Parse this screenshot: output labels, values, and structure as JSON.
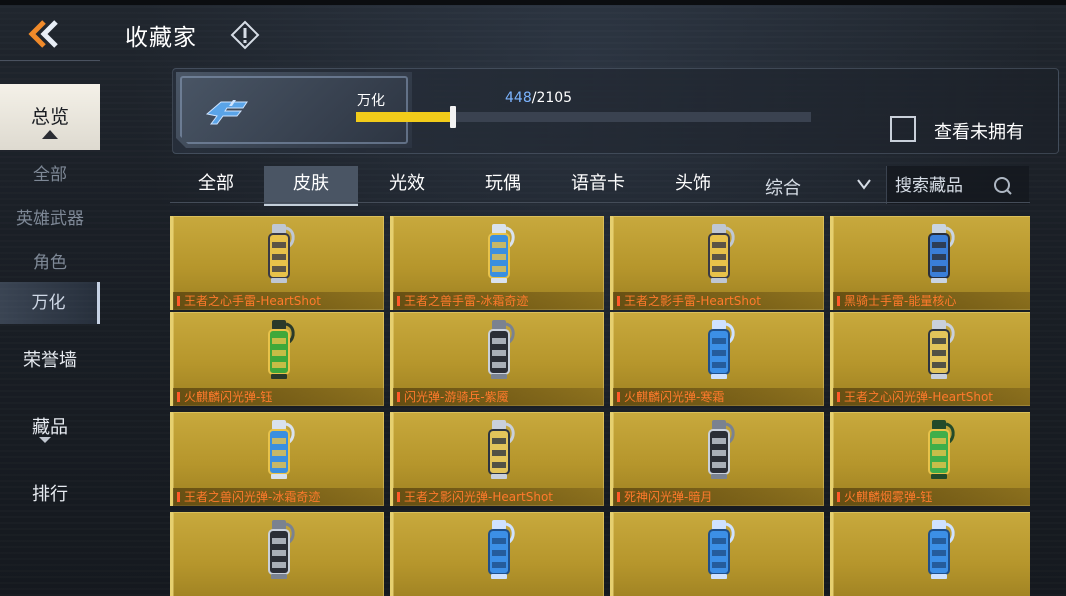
{
  "header": {
    "title": "收藏家",
    "back_icon": "double-chevron-left-icon",
    "info_icon": "exclamation-diamond-icon"
  },
  "sidebar": {
    "main_active": "总览",
    "sub_items": [
      "全部",
      "英雄武器",
      "角色"
    ],
    "sub_active": "万化",
    "main_items": [
      "荣誉墙",
      "藏品",
      "排行"
    ]
  },
  "progress": {
    "label": "万化",
    "current": "448",
    "total": "/2105",
    "fraction": 0.213,
    "bar_color": "#f2cc1a"
  },
  "owned_filter": {
    "label": "查看未拥有",
    "checked": false
  },
  "tabs": {
    "items": [
      "全部",
      "皮肤",
      "光效",
      "玩偶",
      "语音卡",
      "头饰"
    ],
    "active": "皮肤"
  },
  "sort": {
    "label": "综合"
  },
  "search": {
    "placeholder": "搜索藏品"
  },
  "items": [
    {
      "name": "王者之心手雷-HeartShot",
      "icon": "grenade-gold-icon"
    },
    {
      "name": "王者之兽手雷-冰霜奇迹",
      "icon": "grenade-dragon-blue-icon"
    },
    {
      "name": "王者之影手雷-HeartShot",
      "icon": "grenade-gold-icon"
    },
    {
      "name": "黑骑士手雷-能量核心",
      "icon": "grenade-blue-icon"
    },
    {
      "name": "火麒麟闪光弹-钰",
      "icon": "flashbang-green-icon"
    },
    {
      "name": "闪光弹-游骑兵-紫魇",
      "icon": "flashbang-dark-icon"
    },
    {
      "name": "火麒麟闪光弹-寒霜",
      "icon": "flashbang-blue-icon"
    },
    {
      "name": "王者之心闪光弹-HeartShot",
      "icon": "flashbang-gold-icon"
    },
    {
      "name": "王者之兽闪光弹-冰霜奇迹",
      "icon": "grenade-dragon-blue-icon"
    },
    {
      "name": "王者之影闪光弹-HeartShot",
      "icon": "flashbang-gold-icon"
    },
    {
      "name": "死神闪光弹-暗月",
      "icon": "flashbang-dark-icon"
    },
    {
      "name": "火麒麟烟雾弹-钰",
      "icon": "smoke-green-icon"
    },
    {
      "name": "",
      "icon": "flashbang-dark-icon"
    },
    {
      "name": "",
      "icon": "flashbang-blue-icon"
    },
    {
      "name": "",
      "icon": "flashbang-blue-icon"
    },
    {
      "name": "",
      "icon": "flashbang-blue-icon"
    }
  ]
}
